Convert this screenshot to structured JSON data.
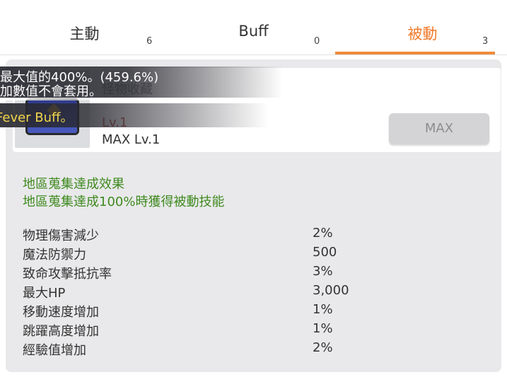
{
  "tabs": [
    {
      "label": "主動",
      "count": "6",
      "active": false
    },
    {
      "label": "Buff",
      "count": "0",
      "active": false
    },
    {
      "label": "被動",
      "count": "3",
      "active": true
    }
  ],
  "accent_color": "#f07a2a",
  "skill": {
    "name": "怪物收藏",
    "level": "Lv.1",
    "max_level": "MAX Lv.1",
    "button_label": "MAX",
    "icon": "monster-collection-icon"
  },
  "tooltip": {
    "line1": "最大值的400%。(459.6%)",
    "line2": "加數值不會套用。",
    "line3": "Fever Buff。"
  },
  "effects": {
    "title": "地區蒐集達成效果",
    "subtitle": "地區蒐集達成100%時獲得被動技能",
    "stats": [
      {
        "name": "物理傷害減少",
        "value": "2%"
      },
      {
        "name": "魔法防禦力",
        "value": "500"
      },
      {
        "name": "致命攻擊抵抗率",
        "value": "3%"
      },
      {
        "name": "最大HP",
        "value": "3,000"
      },
      {
        "name": "移動速度增加",
        "value": "1%"
      },
      {
        "name": "跳躍高度增加",
        "value": "1%"
      },
      {
        "name": "經驗值增加",
        "value": "2%"
      }
    ]
  }
}
